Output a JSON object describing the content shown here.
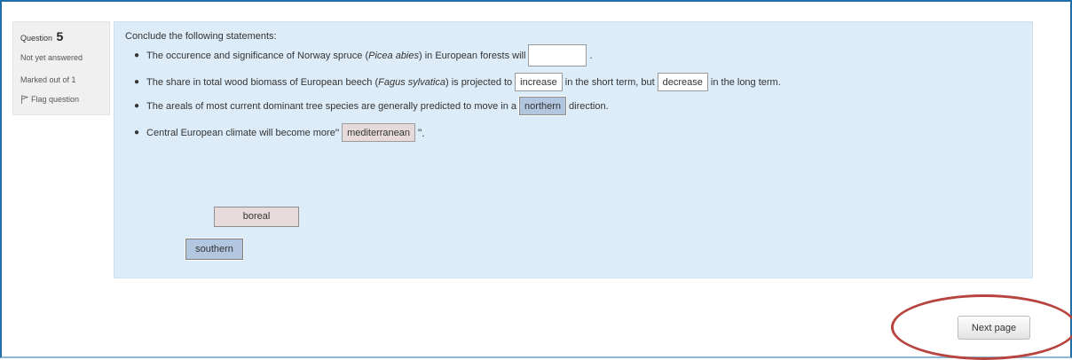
{
  "question_info": {
    "label": "Question",
    "number": "5",
    "state": "Not yet answered",
    "mark": "Marked out of 1",
    "flag_label": "Flag question"
  },
  "question": {
    "intro": "Conclude the following statements:",
    "s1": {
      "before": "The occurence and significance of Norway spruce (",
      "italic": "Picea abies",
      "after": ") in European forests will",
      "blank": "",
      "end": "."
    },
    "s2": {
      "before": "The share in total wood biomass of European beech (",
      "italic": "Fagus sylvatica",
      "middle": ") is projected to",
      "drop1": "increase",
      "between": "in the short term, but",
      "drop2": "decrease",
      "end": "in the long term."
    },
    "s3": {
      "before": "The areals of most current dominant tree species are generally predicted to move in a",
      "drop": "northern",
      "after": "direction."
    },
    "s4": {
      "before": "Central European climate will become more",
      "open_quote": "\"",
      "drop": "mediterranean",
      "close_quote": "\"."
    }
  },
  "draggables": {
    "boreal": "boreal",
    "southern": "southern"
  },
  "navigation": {
    "next_label": "Next page"
  },
  "colors": {
    "frame_border": "#1f6fa8",
    "content_bg": "#dcecf8",
    "info_bg": "#f0f0f0",
    "choice_blue": "#b3c6e0",
    "choice_pink": "#e6dada",
    "annotation": "#b8443f"
  }
}
